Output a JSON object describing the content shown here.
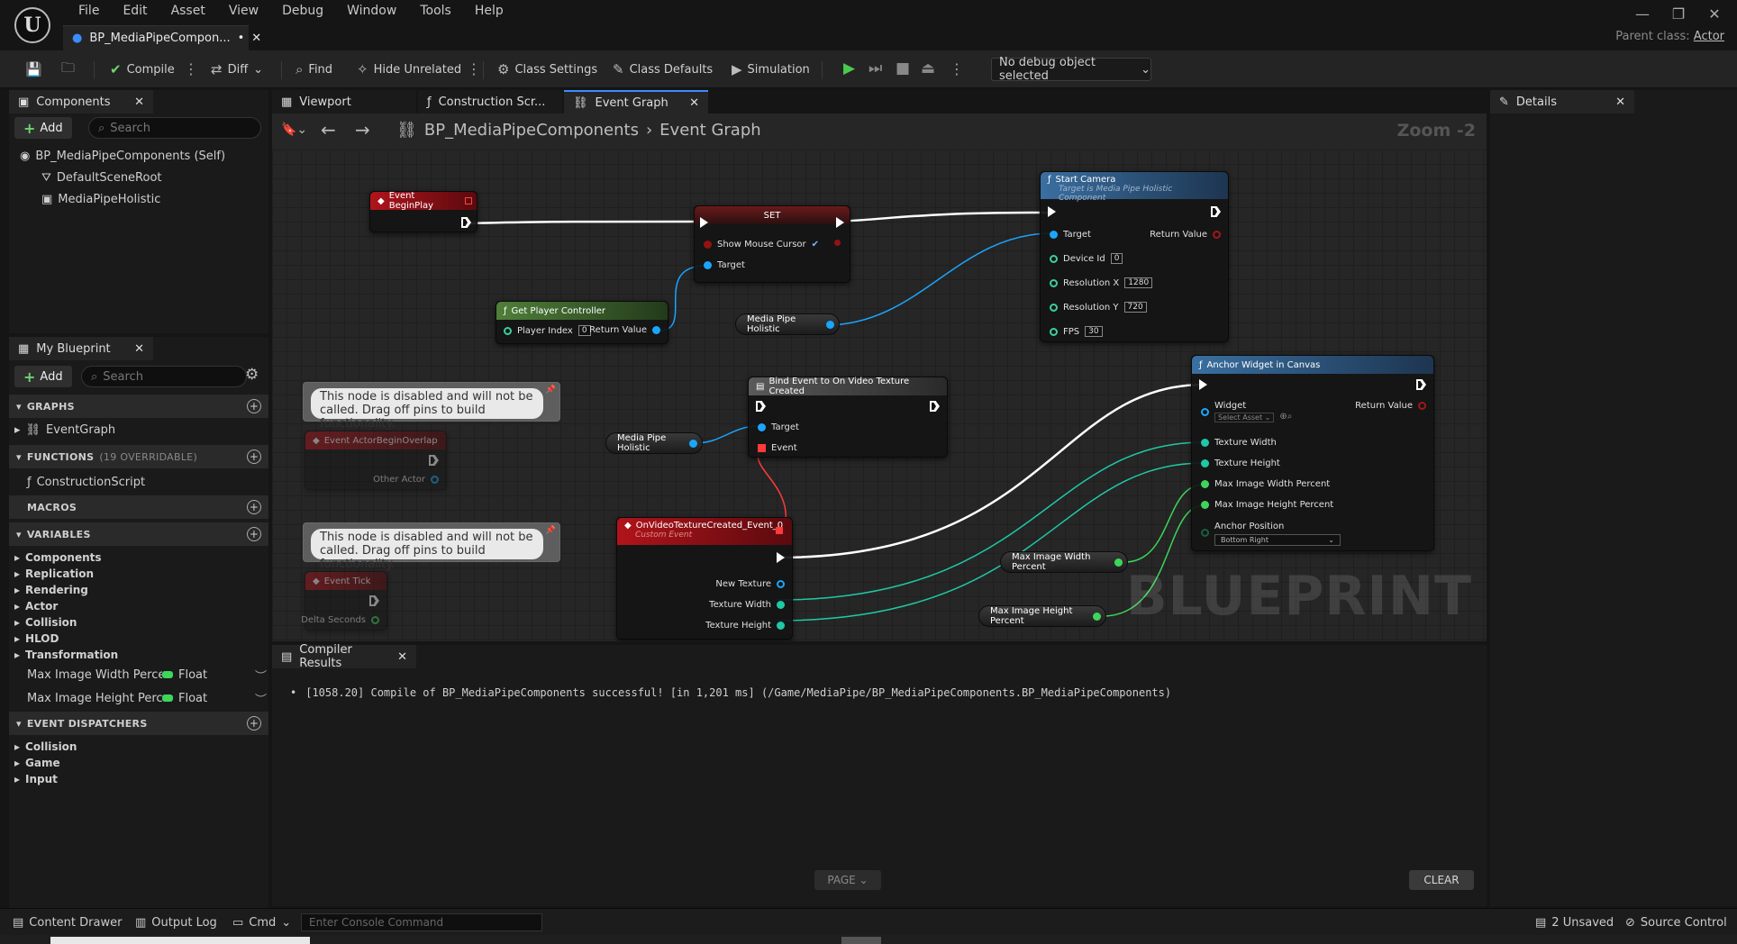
{
  "titlebar": {
    "menu": [
      "File",
      "Edit",
      "Asset",
      "View",
      "Debug",
      "Window",
      "Tools",
      "Help"
    ],
    "doc_tab": "BP_MediaPipeCompon...",
    "doc_tab_dirty": "•",
    "parent_label": "Parent class:",
    "parent_value": "Actor",
    "logo": "U"
  },
  "toolbar": {
    "compile": "Compile",
    "diff": "Diff",
    "find": "Find",
    "hide_unrelated": "Hide Unrelated",
    "class_settings": "Class Settings",
    "class_defaults": "Class Defaults",
    "simulation": "Simulation",
    "debug_object": "No debug object selected"
  },
  "components": {
    "tab": "Components",
    "add": "Add",
    "search_placeholder": "Search",
    "items": [
      "BP_MediaPipeComponents (Self)",
      "DefaultSceneRoot",
      "MediaPipeHolistic"
    ]
  },
  "my_blueprint": {
    "tab": "My Blueprint",
    "add": "Add",
    "search_placeholder": "Search",
    "graphs_header": "GRAPHS",
    "graphs": [
      "EventGraph"
    ],
    "functions_header": "FUNCTIONS",
    "functions_note": "(19 OVERRIDABLE)",
    "functions": [
      "ConstructionScript"
    ],
    "macros_header": "MACROS",
    "variables_header": "VARIABLES",
    "variable_groups": [
      "Components",
      "Replication",
      "Rendering",
      "Actor",
      "Collision",
      "HLOD",
      "Transformation"
    ],
    "variables": [
      {
        "name": "Max Image Width Percen",
        "type": "Float"
      },
      {
        "name": "Max Image Height Perce",
        "type": "Float"
      }
    ],
    "dispatchers_header": "EVENT DISPATCHERS",
    "dispatchers": [
      "Collision",
      "Game",
      "Input"
    ]
  },
  "editor_tabs": [
    "Viewport",
    "Construction Scr...",
    "Event Graph"
  ],
  "breadcrumb": {
    "blueprint": "BP_MediaPipeComponents",
    "graph": "Event Graph"
  },
  "zoom": "Zoom -2",
  "details_tab": "Details",
  "graph": {
    "event_begin_play": "Event BeginPlay",
    "set": {
      "title": "SET",
      "show_mouse_cursor": "Show Mouse Cursor",
      "target": "Target"
    },
    "get_player_controller": {
      "title": "Get Player Controller",
      "player_index": "Player Index",
      "player_index_val": "0",
      "return_value": "Return Value"
    },
    "media_pipe_holistic": "Media Pipe Holistic",
    "start_camera": {
      "title": "Start Camera",
      "subtitle": "Target is Media Pipe Holistic Component",
      "target": "Target",
      "return_value": "Return Value",
      "device_id": "Device Id",
      "device_id_val": "0",
      "res_x": "Resolution X",
      "res_x_val": "1280",
      "res_y": "Resolution Y",
      "res_y_val": "720",
      "fps": "FPS",
      "fps_val": "30"
    },
    "comment_text": "This node is disabled and will not be called. Drag off pins to build functionality.",
    "event_actor_begin_overlap": {
      "title": "Event ActorBeginOverlap",
      "other_actor": "Other Actor"
    },
    "event_tick": {
      "title": "Event Tick",
      "delta_seconds": "Delta Seconds"
    },
    "bind_event": {
      "title": "Bind Event to On Video Texture Created",
      "target": "Target",
      "event": "Event"
    },
    "custom_event": {
      "title": "OnVideoTextureCreated_Event_0",
      "subtitle": "Custom Event",
      "new_texture": "New Texture",
      "texture_width": "Texture Width",
      "texture_height": "Texture Height"
    },
    "anchor_widget": {
      "title": "Anchor Widget in Canvas",
      "widget": "Widget",
      "select_asset": "Select Asset",
      "return_value": "Return Value",
      "texture_width": "Texture Width",
      "texture_height": "Texture Height",
      "max_w": "Max Image Width Percent",
      "max_h": "Max Image Height Percent",
      "anchor_position": "Anchor Position",
      "anchor_val": "Bottom Right"
    },
    "var_max_w": "Max Image Width Percent",
    "var_max_h": "Max Image Height Percent",
    "watermark": "BLUEPRINT"
  },
  "compiler": {
    "tab": "Compiler Results",
    "message": "[1058.20] Compile of BP_MediaPipeComponents successful! [in 1,201 ms] (/Game/MediaPipe/BP_MediaPipeComponents.BP_MediaPipeComponents)",
    "page": "PAGE",
    "clear": "CLEAR"
  },
  "status": {
    "content_drawer": "Content Drawer",
    "output_log": "Output Log",
    "cmd": "Cmd",
    "console_placeholder": "Enter Console Command",
    "unsaved": "2 Unsaved",
    "source_control": "Source Control"
  },
  "colors": {
    "exec": "#ffffff",
    "object_pin": "#1aa6ff",
    "float_pin": "#3dd65b",
    "event_pin": "#ff3a3a",
    "bool_pin": "#931313"
  }
}
